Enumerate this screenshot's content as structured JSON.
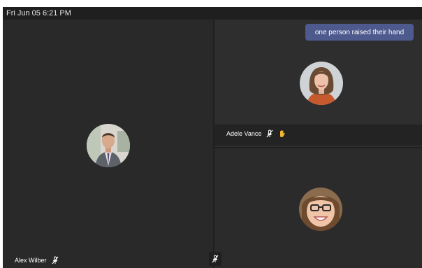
{
  "status_bar": {
    "datetime": "Fri Jun 05  6:21 PM"
  },
  "notification": {
    "text": "one person raised their hand"
  },
  "participants": [
    {
      "name": "Alex Wilber",
      "muted": true,
      "hand_raised": false
    },
    {
      "name": "Adele Vance",
      "muted": true,
      "hand_raised": true
    },
    {
      "name": "",
      "muted": false,
      "hand_raised": false
    }
  ],
  "colors": {
    "background": "#292929",
    "toast": "#4e5a8e",
    "hand": "#f5b730"
  },
  "icons": {
    "muted": "mic-off-icon",
    "hand": "raised-hand-icon"
  }
}
